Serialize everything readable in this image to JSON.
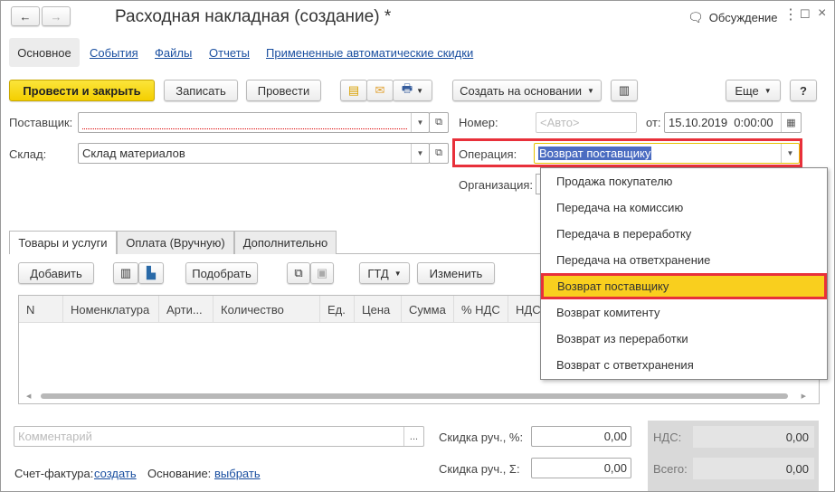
{
  "window": {
    "title": "Расходная накладная (создание) *",
    "discussion": "Обсуждение"
  },
  "nav_tabs": [
    "Основное",
    "События",
    "Файлы",
    "Отчеты",
    "Примененные автоматические скидки"
  ],
  "toolbar": {
    "post_close": "Провести и закрыть",
    "save": "Записать",
    "post": "Провести",
    "create_based": "Создать на основании",
    "more": "Еще",
    "help": "?"
  },
  "form": {
    "supplier_label": "Поставщик:",
    "supplier_value": "",
    "warehouse_label": "Склад:",
    "warehouse_value": "Склад материалов",
    "number_label": "Номер:",
    "number_placeholder": "<Авто>",
    "date_label": "от:",
    "date_value": "15.10.2019  0:00:00",
    "operation_label": "Операция:",
    "operation_value": "Возврат поставщику",
    "organization_label": "Организация:"
  },
  "operation_options": [
    "Продажа покупателю",
    "Передача на комиссию",
    "Передача в переработку",
    "Передача на ответхранение",
    "Возврат поставщику",
    "Возврат комитенту",
    "Возврат из переработки",
    "Возврат с ответхранения"
  ],
  "selected_option_index": 4,
  "doc_tabs": [
    "Товары и услуги",
    "Оплата (Вручную)",
    "Дополнительно"
  ],
  "table_toolbar": {
    "add": "Добавить",
    "pick": "Подобрать",
    "gtd": "ГТД",
    "change": "Изменить"
  },
  "table_columns": [
    "N",
    "Номенклатура",
    "Арти...",
    "Количество",
    "Ед.",
    "Цена",
    "Сумма",
    "% НДС",
    "НДС"
  ],
  "footer": {
    "comment_placeholder": "Комментарий",
    "discount_pct_label": "Скидка руч., %:",
    "discount_pct_value": "0,00",
    "discount_sum_label": "Скидка руч., Σ:",
    "discount_sum_value": "0,00",
    "vat_label": "НДС:",
    "vat_value": "0,00",
    "total_label": "Всего:",
    "total_value": "0,00",
    "invoice_label": "Счет-фактура:",
    "invoice_link": "создать",
    "basis_label": "Основание:",
    "basis_link": "выбрать"
  },
  "colors": {
    "accent_yellow": "#f4cf00",
    "highlight_red": "#e8303a",
    "selection_blue": "#4b6cc1",
    "link": "#1a4fa0"
  }
}
